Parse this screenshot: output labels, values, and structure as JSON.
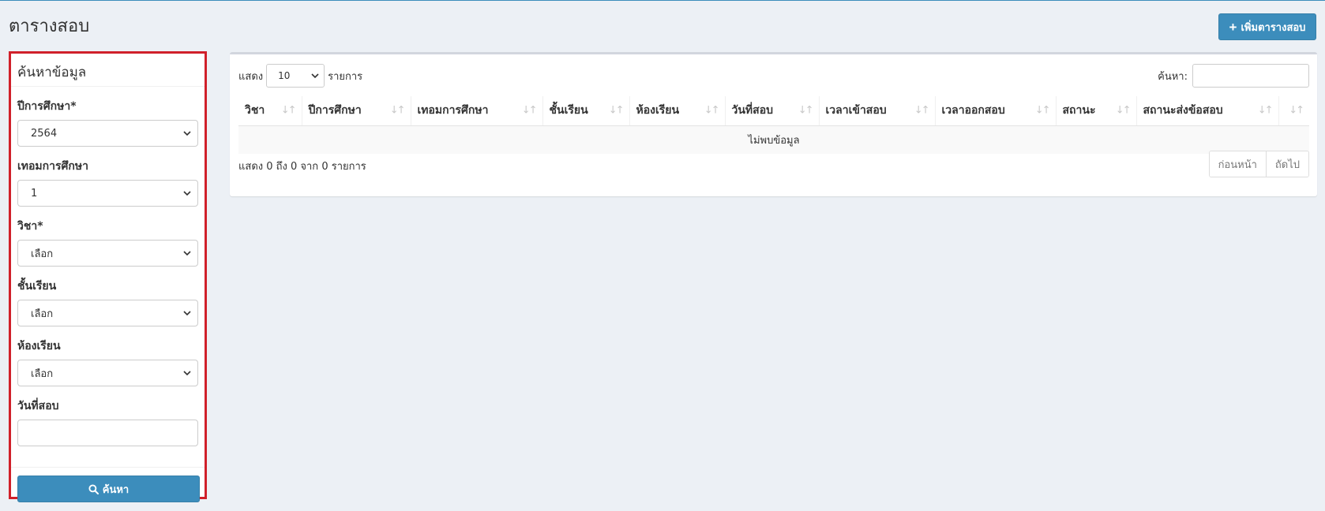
{
  "page": {
    "title": "ตารางสอบ"
  },
  "header": {
    "add_button_label": "เพิ่มตารางสอบ"
  },
  "search_panel": {
    "title": "ค้นหาข้อมูล",
    "fields": [
      {
        "label": "ปีการศึกษา*",
        "type": "select",
        "value": "2564"
      },
      {
        "label": "เทอมการศึกษา",
        "type": "select",
        "value": "1"
      },
      {
        "label": "วิชา*",
        "type": "select",
        "value": "เลือก"
      },
      {
        "label": "ชั้นเรียน",
        "type": "select",
        "value": "เลือก"
      },
      {
        "label": "ห้องเรียน",
        "type": "select",
        "value": "เลือก"
      },
      {
        "label": "วันที่สอบ",
        "type": "text",
        "value": ""
      }
    ],
    "search_button_label": "ค้นหา",
    "highlight_color": "#d0202a"
  },
  "results": {
    "length_prefix": "แสดง",
    "length_value": "10",
    "length_suffix": "รายการ",
    "filter_label": "ค้นหา:",
    "filter_value": "",
    "columns": [
      "วิชา",
      "ปีการศึกษา",
      "เทอมการศึกษา",
      "ชั้นเรียน",
      "ห้องเรียน",
      "วันที่สอบ",
      "เวลาเข้าสอบ",
      "เวลาออกสอบ",
      "สถานะ",
      "สถานะส่งข้อสอบ",
      ""
    ],
    "empty_message": "ไม่พบข้อมูล",
    "info": "แสดง 0 ถึง 0 จาก 0 รายการ",
    "pagination": {
      "previous": "ก่อนหน้า",
      "next": "ถัดไป"
    }
  },
  "colors": {
    "primary": "#3c8dbc",
    "background": "#ecf0f5"
  }
}
